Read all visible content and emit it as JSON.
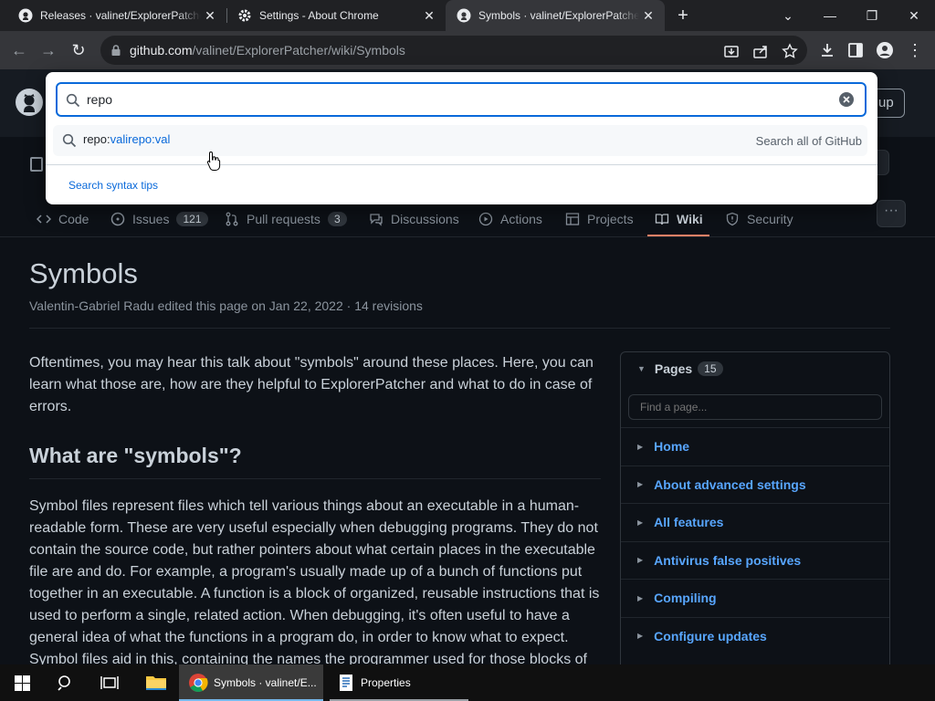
{
  "browser": {
    "tabs": [
      {
        "title": "Releases · valinet/ExplorerPatcher",
        "active": false
      },
      {
        "title": "Settings - About Chrome",
        "active": false
      },
      {
        "title": "Symbols · valinet/ExplorerPatcher",
        "active": true
      }
    ],
    "url_host": "github.com",
    "url_path": "/valinet/ExplorerPatcher/wiki/Symbols"
  },
  "header": {
    "signup_label": "up"
  },
  "repo_nav": [
    {
      "label": "Code",
      "icon": "code-icon"
    },
    {
      "label": "Issues",
      "icon": "issue-icon",
      "count": "121"
    },
    {
      "label": "Pull requests",
      "icon": "pull-request-icon",
      "count": "3"
    },
    {
      "label": "Discussions",
      "icon": "comment-icon"
    },
    {
      "label": "Actions",
      "icon": "play-icon"
    },
    {
      "label": "Projects",
      "icon": "table-icon"
    },
    {
      "label": "Wiki",
      "icon": "book-icon",
      "selected": true
    },
    {
      "label": "Security",
      "icon": "shield-icon"
    }
  ],
  "wiki": {
    "title": "Symbols",
    "meta": "Valentin-Gabriel Radu edited this page on Jan 22, 2022 · 14 revisions",
    "intro": "Oftentimes, you may hear this talk about \"symbols\" around these places. Here, you can learn what those are, how are they helpful to ExplorerPatcher and what to do in case of errors.",
    "heading": "What are \"symbols\"?",
    "body": "Symbol files represent files which tell various things about an executable in a human-readable form. These are very useful especially when debugging programs. They do not contain the source code, but rather pointers about what certain places in the executable file are and do. For example, a program's usually made up of a bunch of functions put together in an executable. A function is a block of organized, reusable instructions that is used to perform a single, related action. When debugging, it's often useful to have a general idea of what the functions in a program do, in order to know what to expect. Symbol files aid in this, containing the names the programmer used for those blocks of"
  },
  "pages": {
    "label": "Pages",
    "count": "15",
    "find_placeholder": "Find a page...",
    "items": [
      "Home",
      "About advanced settings",
      "All features",
      "Antivirus false positives",
      "Compiling",
      "Configure updates"
    ]
  },
  "search": {
    "query": "repo",
    "suggestion_prefix": "repo:",
    "suggestion_value": "valirepo:val",
    "scope": "Search all of GitHub",
    "tips": "Search syntax tips"
  },
  "taskbar": {
    "apps": [
      {
        "label": "Symbols · valinet/E...",
        "active": true
      },
      {
        "label": "Properties",
        "active": false
      }
    ]
  },
  "colors": {
    "accent": "#0969da",
    "link": "#58a6ff",
    "wiki_underline": "#f78166",
    "bg": "#0d1117"
  }
}
